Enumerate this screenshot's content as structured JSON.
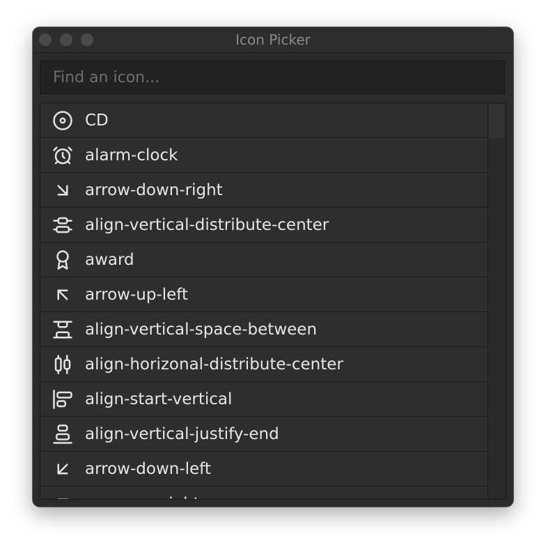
{
  "window": {
    "title": "Icon Picker"
  },
  "search": {
    "placeholder": "Find an icon...",
    "value": ""
  },
  "icons": [
    {
      "label": "CD",
      "icon": "disc-icon"
    },
    {
      "label": "alarm-clock",
      "icon": "alarm-clock-icon"
    },
    {
      "label": "arrow-down-right",
      "icon": "arrow-down-right-icon"
    },
    {
      "label": "align-vertical-distribute-center",
      "icon": "align-vertical-distribute-center-icon"
    },
    {
      "label": "award",
      "icon": "award-icon"
    },
    {
      "label": "arrow-up-left",
      "icon": "arrow-up-left-icon"
    },
    {
      "label": "align-vertical-space-between",
      "icon": "align-vertical-space-between-icon"
    },
    {
      "label": "align-horizonal-distribute-center",
      "icon": "align-horizontal-distribute-center-icon"
    },
    {
      "label": "align-start-vertical",
      "icon": "align-start-vertical-icon"
    },
    {
      "label": "align-vertical-justify-end",
      "icon": "align-vertical-justify-end-icon"
    },
    {
      "label": "arrow-down-left",
      "icon": "arrow-down-left-icon"
    },
    {
      "label": "arrow-up-right",
      "icon": "arrow-up-right-icon"
    }
  ],
  "colors": {
    "window_bg": "#2b2b2b",
    "row_bg": "#2e2e2e",
    "text": "#e6e6e6",
    "title_text": "#8a8a8a",
    "placeholder_text": "#6e6e6e"
  }
}
